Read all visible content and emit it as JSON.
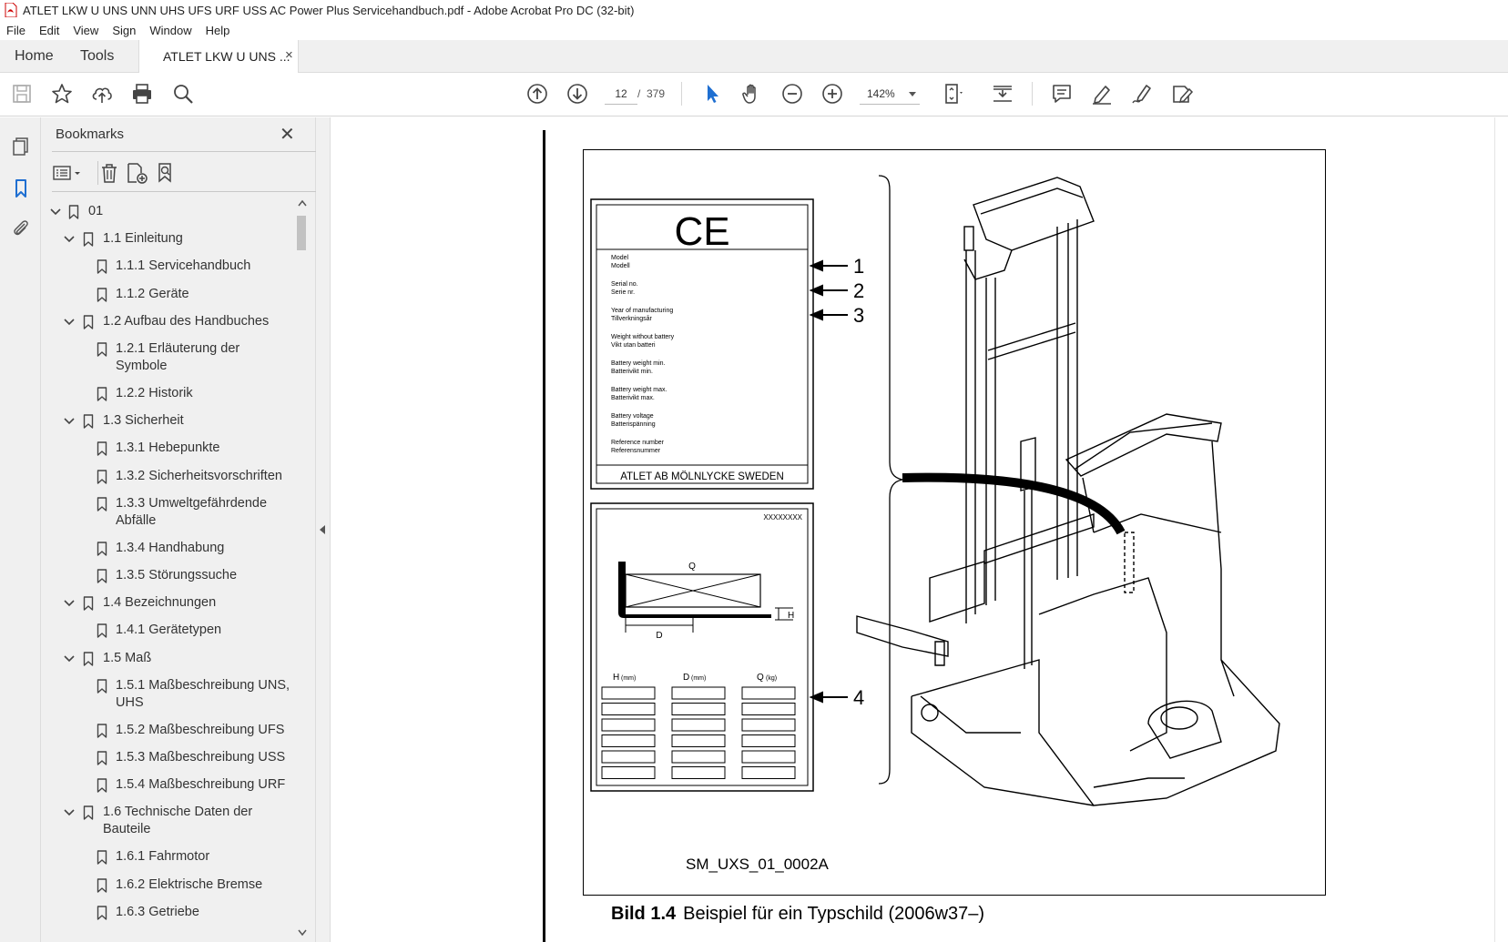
{
  "window": {
    "title": "ATLET LKW U UNS UNN UHS UFS URF USS AC Power Plus Servicehandbuch.pdf - Adobe Acrobat Pro DC (32-bit)"
  },
  "menu": [
    "File",
    "Edit",
    "View",
    "Sign",
    "Window",
    "Help"
  ],
  "tabs": {
    "home": "Home",
    "tools": "Tools",
    "document": "ATLET LKW U UNS ...",
    "close": "×"
  },
  "toolbar": {
    "page_current": "12",
    "page_sep": "/",
    "page_total": "379",
    "zoom": "142%"
  },
  "bookmarks_panel": {
    "title": "Bookmarks",
    "close": "✕",
    "items": [
      {
        "label": "01",
        "level": 0,
        "expandable": true
      },
      {
        "label": "1.1 Einleitung",
        "level": 1,
        "expandable": true
      },
      {
        "label": "1.1.1 Servicehandbuch",
        "level": 2,
        "expandable": false
      },
      {
        "label": "1.1.2 Geräte",
        "level": 2,
        "expandable": false
      },
      {
        "label": "1.2 Aufbau des Handbuches",
        "level": 1,
        "expandable": true
      },
      {
        "label": "1.2.1 Erläuterung der",
        "label2": "Symbole",
        "level": 2,
        "expandable": false
      },
      {
        "label": "1.2.2 Historik",
        "level": 2,
        "expandable": false
      },
      {
        "label": "1.3 Sicherheit",
        "level": 1,
        "expandable": true
      },
      {
        "label": "1.3.1 Hebepunkte",
        "level": 2,
        "expandable": false
      },
      {
        "label": "1.3.2 Sicherheitsvorschriften",
        "level": 2,
        "expandable": false
      },
      {
        "label": "1.3.3 Umweltgefährdende",
        "label2": "Abfälle",
        "level": 2,
        "expandable": false
      },
      {
        "label": "1.3.4 Handhabung",
        "level": 2,
        "expandable": false
      },
      {
        "label": "1.3.5 Störungssuche",
        "level": 2,
        "expandable": false
      },
      {
        "label": "1.4 Bezeichnungen",
        "level": 1,
        "expandable": true
      },
      {
        "label": "1.4.1 Gerätetypen",
        "level": 2,
        "expandable": false
      },
      {
        "label": "1.5 Maß",
        "level": 1,
        "expandable": true
      },
      {
        "label": "1.5.1 Maßbeschreibung UNS,",
        "label2": "UHS",
        "level": 2,
        "expandable": false
      },
      {
        "label": "1.5.2 Maßbeschreibung UFS",
        "level": 2,
        "expandable": false
      },
      {
        "label": "1.5.3 Maßbeschreibung USS",
        "level": 2,
        "expandable": false
      },
      {
        "label": "1.5.4 Maßbeschreibung URF",
        "level": 2,
        "expandable": false
      },
      {
        "label": "1.6 Technische Daten der",
        "label2": "Bauteile",
        "level": 1,
        "expandable": true
      },
      {
        "label": "1.6.1 Fahrmotor",
        "level": 2,
        "expandable": false
      },
      {
        "label": "1.6.2 Elektrische Bremse",
        "level": 2,
        "expandable": false
      },
      {
        "label": "1.6.3 Getriebe",
        "level": 2,
        "expandable": false
      }
    ]
  },
  "document": {
    "caption_number": "Bild 1.4",
    "caption_text": "Beispiel für ein Typschild (2006w37–)",
    "figure_code": "SM_UXS_01_0002A",
    "plate1": {
      "mark": "CE",
      "fields": [
        [
          "Model",
          "Modell"
        ],
        [
          "Serial no.",
          "Serie nr."
        ],
        [
          "Year of manufacturing",
          "Tillverkningsår"
        ],
        [
          "Weight without battery",
          "Vikt utan batteri"
        ],
        [
          "Battery weight min.",
          "Batterivikt min."
        ],
        [
          "Battery weight max.",
          "Batterivikt max."
        ],
        [
          "Battery voltage",
          "Batterispänning"
        ],
        [
          "Reference number",
          "Referensnummer"
        ]
      ],
      "footer": "ATLET AB MÖLNLYCKE SWEDEN"
    },
    "plate2": {
      "code": "XXXXXXXX",
      "q_label": "Q",
      "d_label": "D",
      "h_label": "H",
      "col_h": "H",
      "col_d": "D",
      "col_q": "Q",
      "unit_mm": "(mm)",
      "unit_kg": "(kg)"
    },
    "callouts": [
      "1",
      "2",
      "3",
      "4"
    ]
  }
}
